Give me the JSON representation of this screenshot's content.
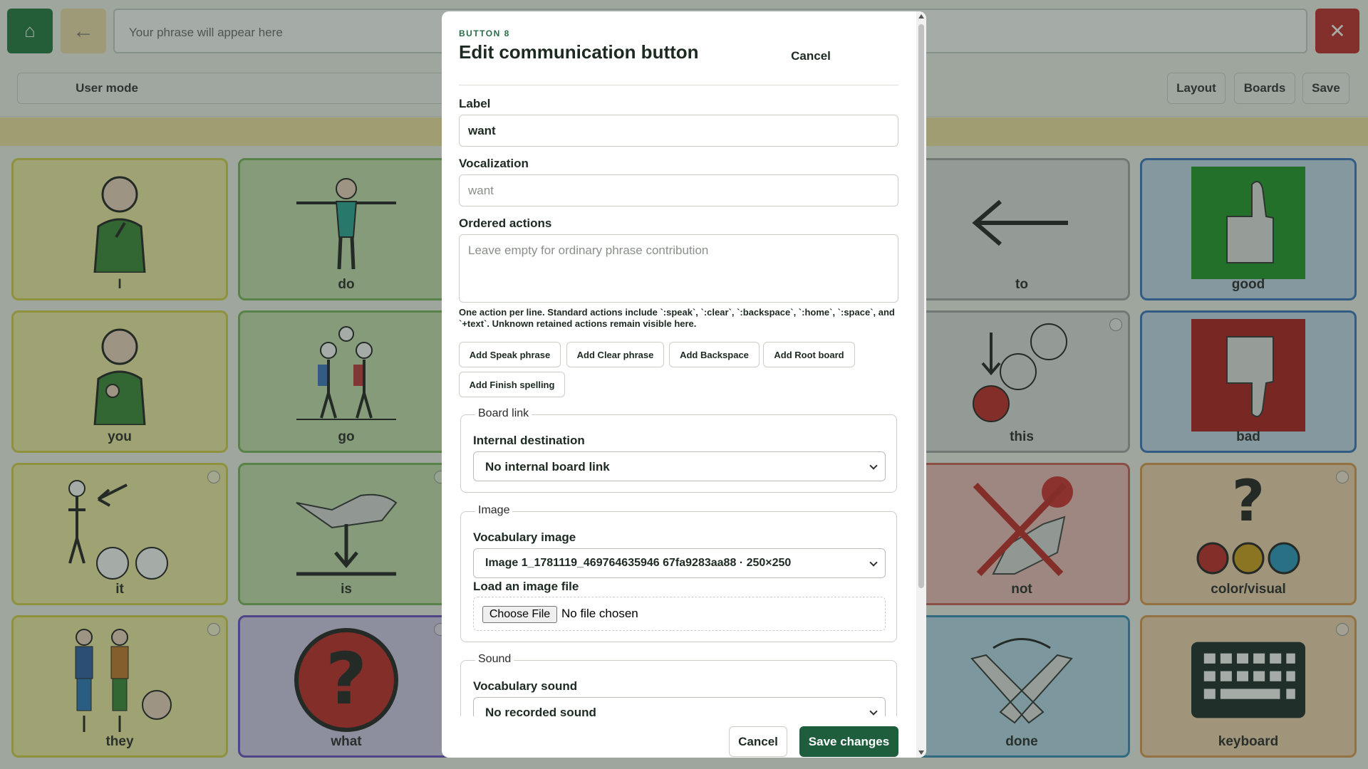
{
  "app": {
    "home_icon": "home-icon",
    "back_icon": "back-arrow-icon",
    "phrase_placeholder": "Your phrase will appear here",
    "clear_icon": "close-icon",
    "mode_label": "User mode",
    "layout_label": "Layout",
    "boards_label": "Boards",
    "save_label": "Save",
    "colors": {
      "home": "#217a43",
      "clear": "#c52a2a",
      "notice": "#f7e7a6"
    }
  },
  "tiles": [
    {
      "label": "I",
      "icon": "person-self-icon"
    },
    {
      "label": "do",
      "icon": "person-arms-out-icon"
    },
    {
      "label": "to",
      "icon": "left-arrow-icon"
    },
    {
      "label": "good",
      "icon": "thumbs-up-icon"
    },
    {
      "label": "you",
      "icon": "person-pointing-icon"
    },
    {
      "label": "go",
      "icon": "people-walking-icon"
    },
    {
      "label": "this",
      "icon": "this-circles-icon"
    },
    {
      "label": "bad",
      "icon": "thumbs-down-icon"
    },
    {
      "label": "it",
      "icon": "it-figure-icon"
    },
    {
      "label": "is",
      "icon": "hand-down-icon"
    },
    {
      "label": "not",
      "icon": "not-cross-icon"
    },
    {
      "label": "color/visual",
      "icon": "color-question-icon"
    },
    {
      "label": "they",
      "icon": "people-group-icon"
    },
    {
      "label": "what",
      "icon": "question-icon"
    },
    {
      "label": "done",
      "icon": "done-hands-icon"
    },
    {
      "label": "keyboard",
      "icon": "keyboard-icon"
    }
  ],
  "modal": {
    "eyebrow": "BUTTON 8",
    "title": "Edit communication button",
    "cancel_label": "Cancel",
    "label_field": {
      "label": "Label",
      "value": "want"
    },
    "vocalization_field": {
      "label": "Vocalization",
      "placeholder": "want"
    },
    "actions_field": {
      "label": "Ordered actions",
      "placeholder": "Leave empty for ordinary phrase contribution",
      "help": "One action per line. Standard actions include `:speak`, `:clear`, `:backspace`, `:home`, `:space`, and `+text`. Unknown retained actions remain visible here."
    },
    "action_buttons": [
      "Add Speak phrase",
      "Add Clear phrase",
      "Add Backspace",
      "Add Root board",
      "Add Finish spelling"
    ],
    "board_link": {
      "legend": "Board link",
      "label": "Internal destination",
      "selected": "No internal board link"
    },
    "image": {
      "legend": "Image",
      "vocab_label": "Vocabulary image",
      "selected": "Image 1_1781119_469764635946 67fa9283aa88 · 250×250",
      "load_label": "Load an image file",
      "choose_label": "Choose File",
      "no_file": "No file chosen"
    },
    "sound": {
      "legend": "Sound",
      "vocab_label": "Vocabulary sound",
      "selected": "No recorded sound"
    },
    "footer_cancel": "Cancel",
    "footer_save": "Save changes",
    "colors": {
      "accent": "#1f5e3d",
      "eyebrow": "#2a6b48"
    }
  }
}
